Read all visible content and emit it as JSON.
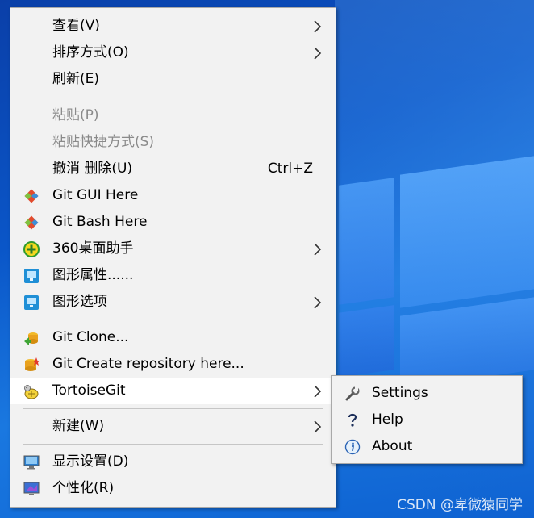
{
  "menu": {
    "items": [
      {
        "label": "查看(V)",
        "submenu": true
      },
      {
        "label": "排序方式(O)",
        "submenu": true
      },
      {
        "label": "刷新(E)"
      },
      {
        "label": "粘贴(P)",
        "disabled": true
      },
      {
        "label": "粘贴快捷方式(S)",
        "disabled": true
      },
      {
        "label": "撤消 删除(U)",
        "shortcut": "Ctrl+Z"
      },
      {
        "label": "Git GUI Here",
        "icon": "git-diamond-icon"
      },
      {
        "label": "Git Bash Here",
        "icon": "git-diamond-icon"
      },
      {
        "label": "360桌面助手",
        "icon": "360-plus-icon",
        "submenu": true
      },
      {
        "label": "图形属性......",
        "icon": "intel-graphics-icon"
      },
      {
        "label": "图形选项",
        "icon": "intel-graphics-icon",
        "submenu": true
      },
      {
        "label": "Git Clone...",
        "icon": "git-clone-icon"
      },
      {
        "label": "Git Create repository here...",
        "icon": "git-create-repo-icon"
      },
      {
        "label": "TortoiseGit",
        "icon": "tortoisegit-icon",
        "submenu": true,
        "highlighted": true
      },
      {
        "label": "新建(W)",
        "submenu": true
      },
      {
        "label": "显示设置(D)",
        "icon": "display-settings-icon"
      },
      {
        "label": "个性化(R)",
        "icon": "personalize-icon"
      }
    ]
  },
  "submenu": {
    "items": [
      {
        "label": "Settings",
        "icon": "wrench-icon"
      },
      {
        "label": "Help",
        "icon": "help-icon"
      },
      {
        "label": "About",
        "icon": "info-icon"
      }
    ]
  },
  "watermark": "CSDN @卑微猿同学",
  "colors": {
    "menu_bg": "#f2f2f2",
    "highlight_bg": "#ffffff",
    "disabled_text": "#8a8a8a",
    "desktop_blue": "#0a56c8"
  }
}
